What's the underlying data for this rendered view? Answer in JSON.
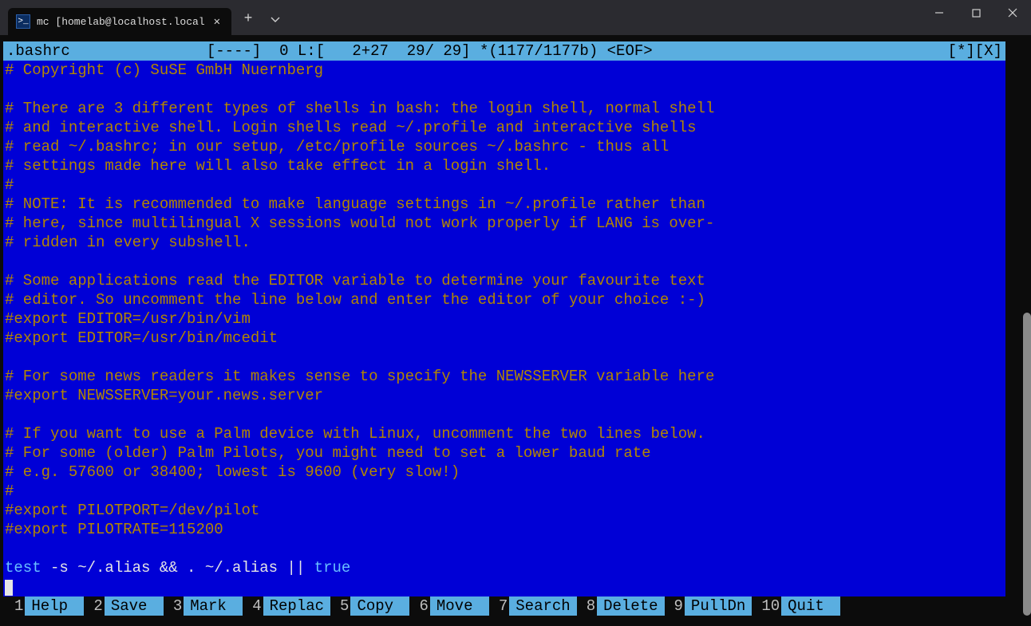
{
  "window": {
    "tab_title": "mc [homelab@localhost.localdc",
    "ps_icon_glyph": ">_"
  },
  "status": {
    "filename": ".bashrc",
    "indicator_left": "[----]",
    "col": "0",
    "lprefix": "L:[",
    "linecol": "2+27",
    "lines": "29/ 29]",
    "bytes": "*(1177/1177b)",
    "eof": "<EOF>",
    "right_flags": "[*][X]"
  },
  "file": {
    "lines": [
      {
        "cls": "comment",
        "t": "# Copyright (c) SuSE GmbH Nuernberg"
      },
      {
        "cls": "",
        "t": ""
      },
      {
        "cls": "comment",
        "t": "# There are 3 different types of shells in bash: the login shell, normal shell"
      },
      {
        "cls": "comment",
        "t": "# and interactive shell. Login shells read ~/.profile and interactive shells"
      },
      {
        "cls": "comment",
        "t": "# read ~/.bashrc; in our setup, /etc/profile sources ~/.bashrc - thus all"
      },
      {
        "cls": "comment",
        "t": "# settings made here will also take effect in a login shell."
      },
      {
        "cls": "comment",
        "t": "#"
      },
      {
        "cls": "comment",
        "t": "# NOTE: It is recommended to make language settings in ~/.profile rather than"
      },
      {
        "cls": "comment",
        "t": "# here, since multilingual X sessions would not work properly if LANG is over-"
      },
      {
        "cls": "comment",
        "t": "# ridden in every subshell."
      },
      {
        "cls": "",
        "t": ""
      },
      {
        "cls": "comment",
        "t": "# Some applications read the EDITOR variable to determine your favourite text"
      },
      {
        "cls": "comment",
        "t": "# editor. So uncomment the line below and enter the editor of your choice :-)"
      },
      {
        "cls": "comment",
        "t": "#export EDITOR=/usr/bin/vim"
      },
      {
        "cls": "comment",
        "t": "#export EDITOR=/usr/bin/mcedit"
      },
      {
        "cls": "",
        "t": ""
      },
      {
        "cls": "comment",
        "t": "# For some news readers it makes sense to specify the NEWSSERVER variable here"
      },
      {
        "cls": "comment",
        "t": "#export NEWSSERVER=your.news.server"
      },
      {
        "cls": "",
        "t": ""
      },
      {
        "cls": "comment",
        "t": "# If you want to use a Palm device with Linux, uncomment the two lines below."
      },
      {
        "cls": "comment",
        "t": "# For some (older) Palm Pilots, you might need to set a lower baud rate"
      },
      {
        "cls": "comment",
        "t": "# e.g. 57600 or 38400; lowest is 9600 (very slow!)"
      },
      {
        "cls": "comment",
        "t": "#"
      },
      {
        "cls": "comment",
        "t": "#export PILOTPORT=/dev/pilot"
      },
      {
        "cls": "comment",
        "t": "#export PILOTRATE=115200"
      },
      {
        "cls": "",
        "t": ""
      }
    ],
    "lastline": {
      "kw1": "test",
      "mid": " -s ~/.alias && . ~/.alias || ",
      "kw2": "true"
    }
  },
  "fkeys": [
    {
      "n": "1",
      "l": "Help"
    },
    {
      "n": "2",
      "l": "Save"
    },
    {
      "n": "3",
      "l": "Mark"
    },
    {
      "n": "4",
      "l": "Replac"
    },
    {
      "n": "5",
      "l": "Copy"
    },
    {
      "n": "6",
      "l": "Move"
    },
    {
      "n": "7",
      "l": "Search"
    },
    {
      "n": "8",
      "l": "Delete"
    },
    {
      "n": "9",
      "l": "PullDn"
    },
    {
      "n": "10",
      "l": "Quit"
    }
  ]
}
